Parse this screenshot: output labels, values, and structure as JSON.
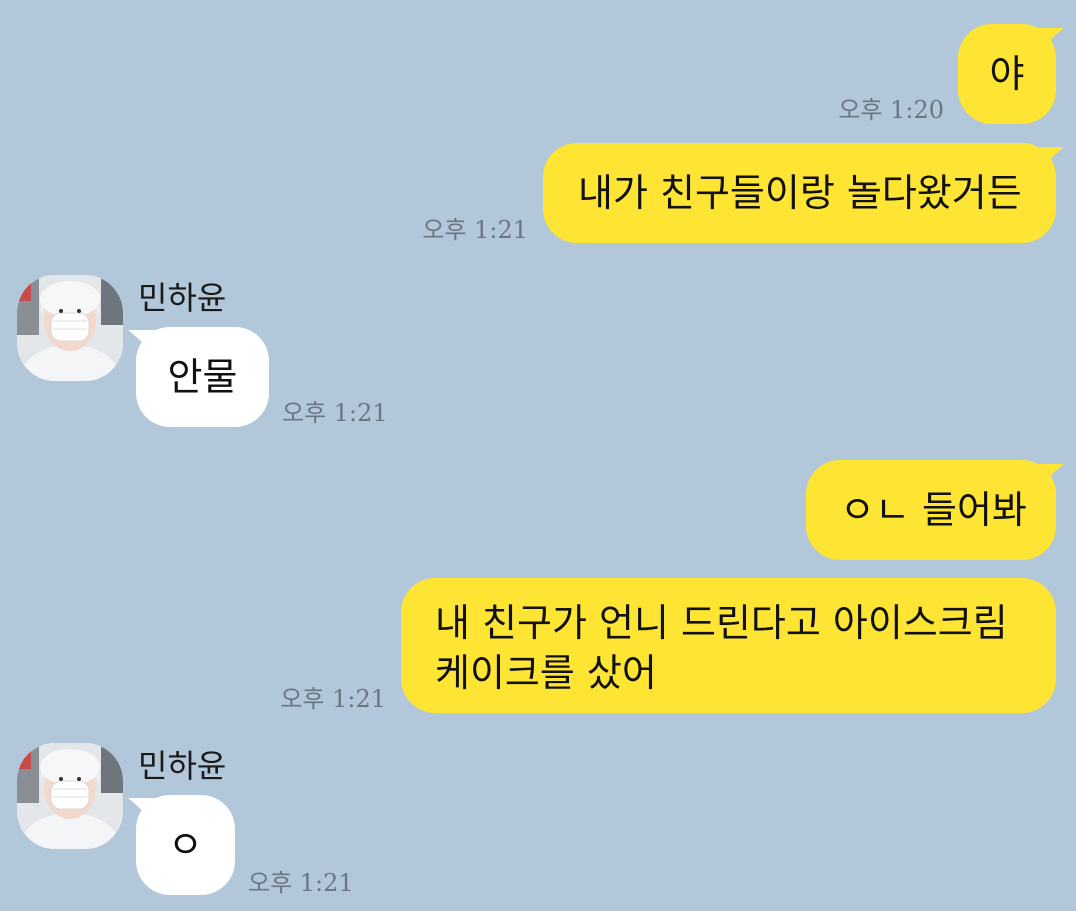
{
  "messages": [
    {
      "sender": "me",
      "text": "야",
      "time": "오후 1:20"
    },
    {
      "sender": "me",
      "text": "내가 친구들이랑 놀다왔거든",
      "time": "오후 1:21"
    },
    {
      "sender": "민하윤",
      "text": "안물",
      "time": "오후 1:21",
      "avatar_icon": "profile-photo"
    },
    {
      "sender": "me",
      "text": "ㅇㄴ 들어봐",
      "time": ""
    },
    {
      "sender": "me",
      "text_lines": [
        "내 친구가 언니 드린다고 아이스크림",
        "케이크를 샀어"
      ],
      "time": "오후 1:21"
    },
    {
      "sender": "민하윤",
      "text": "ㅇ",
      "time": "오후 1:21",
      "avatar_icon": "profile-photo"
    }
  ],
  "colors": {
    "background": "#b2c7da",
    "my_bubble": "#fee533",
    "other_bubble": "#ffffff",
    "time_text": "#6b7682"
  }
}
